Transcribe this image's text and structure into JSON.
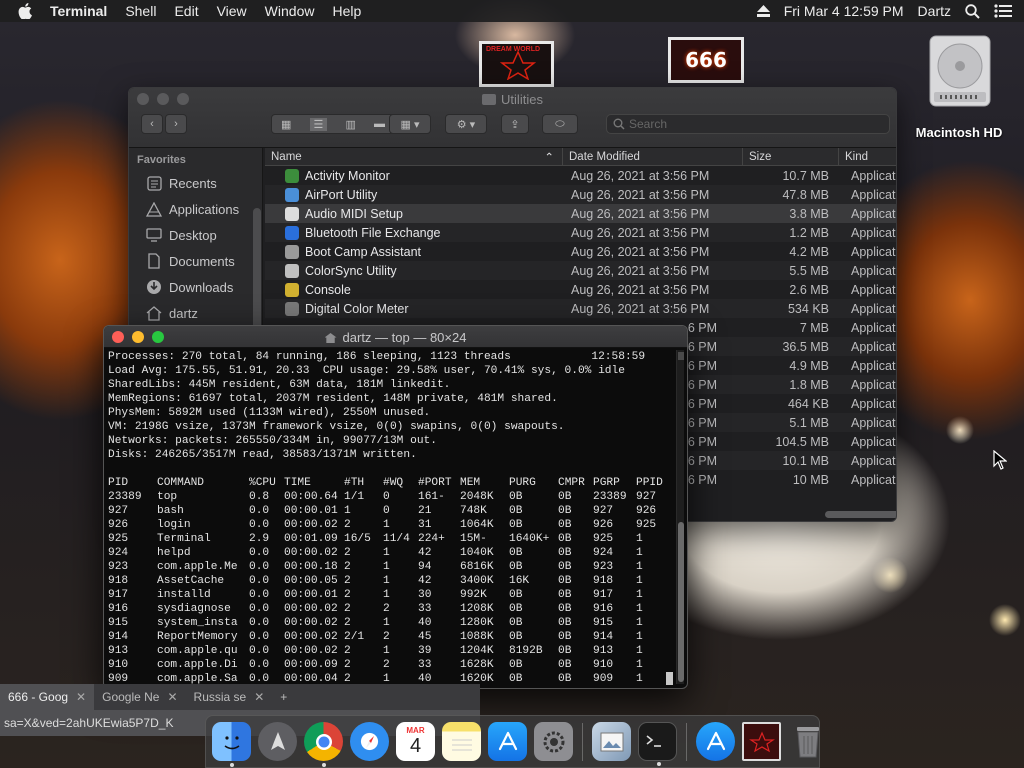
{
  "menubar": {
    "app": "Terminal",
    "items": [
      "Shell",
      "Edit",
      "View",
      "Window",
      "Help"
    ],
    "clock": "Fri Mar 4  12:59 PM",
    "user": "Dartz"
  },
  "desktop": {
    "drive_label": "Macintosh HD",
    "thumb2_text": "666",
    "thumb1_text": "DREAM WORLD"
  },
  "finder": {
    "title": "Utilities",
    "search_placeholder": "Search",
    "sidebar_header": "Favorites",
    "sidebar_items": [
      {
        "label": "Recents",
        "icon": "clock-icon"
      },
      {
        "label": "Applications",
        "icon": "applications-icon"
      },
      {
        "label": "Desktop",
        "icon": "desktop-icon"
      },
      {
        "label": "Documents",
        "icon": "document-icon"
      },
      {
        "label": "Downloads",
        "icon": "download-icon"
      },
      {
        "label": "dartz",
        "icon": "home-icon"
      }
    ],
    "columns": [
      "Name",
      "Date Modified",
      "Size",
      "Kind"
    ],
    "rows": [
      {
        "name": "Activity Monitor",
        "date": "Aug 26, 2021 at 3:56 PM",
        "size": "10.7 MB",
        "kind": "Applicat",
        "color": "#3c8d3c"
      },
      {
        "name": "AirPort Utility",
        "date": "Aug 26, 2021 at 3:56 PM",
        "size": "47.8 MB",
        "kind": "Applicat",
        "color": "#4a8fd8"
      },
      {
        "name": "Audio MIDI Setup",
        "date": "Aug 26, 2021 at 3:56 PM",
        "size": "3.8 MB",
        "kind": "Applicat",
        "color": "#dddddd"
      },
      {
        "name": "Bluetooth File Exchange",
        "date": "Aug 26, 2021 at 3:56 PM",
        "size": "1.2 MB",
        "kind": "Applicat",
        "color": "#2a6fdc"
      },
      {
        "name": "Boot Camp Assistant",
        "date": "Aug 26, 2021 at 3:56 PM",
        "size": "4.2 MB",
        "kind": "Applicat",
        "color": "#9a9a9a"
      },
      {
        "name": "ColorSync Utility",
        "date": "Aug 26, 2021 at 3:56 PM",
        "size": "5.5 MB",
        "kind": "Applicat",
        "color": "#c0c0c0"
      },
      {
        "name": "Console",
        "date": "Aug 26, 2021 at 3:56 PM",
        "size": "2.6 MB",
        "kind": "Applicat",
        "color": "#d0b030"
      },
      {
        "name": "Digital Color Meter",
        "date": "Aug 26, 2021 at 3:56 PM",
        "size": "534 KB",
        "kind": "Applicat",
        "color": "#7a7a7a"
      },
      {
        "name": "",
        "date": "6 PM",
        "size": "7 MB",
        "kind": "Applicat",
        "color": ""
      },
      {
        "name": "",
        "date": "6 PM",
        "size": "36.5 MB",
        "kind": "Applicat",
        "color": ""
      },
      {
        "name": "",
        "date": "6 PM",
        "size": "4.9 MB",
        "kind": "Applicat",
        "color": ""
      },
      {
        "name": "",
        "date": "6 PM",
        "size": "1.8 MB",
        "kind": "Applicat",
        "color": ""
      },
      {
        "name": "",
        "date": "6 PM",
        "size": "464 KB",
        "kind": "Applicat",
        "color": ""
      },
      {
        "name": "",
        "date": "6 PM",
        "size": "5.1 MB",
        "kind": "Applicat",
        "color": ""
      },
      {
        "name": "",
        "date": "6 PM",
        "size": "104.5 MB",
        "kind": "Applicat",
        "color": ""
      },
      {
        "name": "",
        "date": "6 PM",
        "size": "10.1 MB",
        "kind": "Applicat",
        "color": ""
      },
      {
        "name": "",
        "date": "6 PM",
        "size": "10 MB",
        "kind": "Applicat",
        "color": ""
      }
    ]
  },
  "terminal": {
    "title": "dartz — top — 80×24",
    "header_lines": [
      "Processes: 270 total, 84 running, 186 sleeping, 1123 threads            12:58:59",
      "Load Avg: 175.55, 51.91, 20.33  CPU usage: 29.58% user, 70.41% sys, 0.0% idle",
      "SharedLibs: 445M resident, 63M data, 181M linkedit.",
      "MemRegions: 61697 total, 2037M resident, 148M private, 481M shared.",
      "PhysMem: 5892M used (1133M wired), 2550M unused.",
      "VM: 2198G vsize, 1373M framework vsize, 0(0) swapins, 0(0) swapouts.",
      "Networks: packets: 265550/334M in, 99077/13M out.",
      "Disks: 246265/3517M read, 38583/1371M written.",
      ""
    ],
    "columns": [
      "PID",
      "COMMAND",
      "%CPU",
      "TIME",
      "#TH",
      "#WQ",
      "#PORT",
      "MEM",
      "PURG",
      "CMPR",
      "PGRP",
      "PPID"
    ],
    "processes": [
      [
        "23389",
        "top",
        "0.8",
        "00:00.64",
        "1/1",
        "0",
        "161-",
        "2048K",
        "0B",
        "0B",
        "23389",
        "927"
      ],
      [
        "927",
        "bash",
        "0.0",
        "00:00.01",
        "1",
        "0",
        "21",
        "748K",
        "0B",
        "0B",
        "927",
        "926"
      ],
      [
        "926",
        "login",
        "0.0",
        "00:00.02",
        "2",
        "1",
        "31",
        "1064K",
        "0B",
        "0B",
        "926",
        "925"
      ],
      [
        "925",
        "Terminal",
        "2.9",
        "00:01.09",
        "16/5",
        "11/4",
        "224+",
        "15M-",
        "1640K+",
        "0B",
        "925",
        "1"
      ],
      [
        "924",
        "helpd",
        "0.0",
        "00:00.02",
        "2",
        "1",
        "42",
        "1040K",
        "0B",
        "0B",
        "924",
        "1"
      ],
      [
        "923",
        "com.apple.Me",
        "0.0",
        "00:00.18",
        "2",
        "1",
        "94",
        "6816K",
        "0B",
        "0B",
        "923",
        "1"
      ],
      [
        "918",
        "AssetCache",
        "0.0",
        "00:00.05",
        "2",
        "1",
        "42",
        "3400K",
        "16K",
        "0B",
        "918",
        "1"
      ],
      [
        "917",
        "installd",
        "0.0",
        "00:00.01",
        "2",
        "1",
        "30",
        "992K",
        "0B",
        "0B",
        "917",
        "1"
      ],
      [
        "916",
        "sysdiagnose",
        "0.0",
        "00:00.02",
        "2",
        "2",
        "33",
        "1208K",
        "0B",
        "0B",
        "916",
        "1"
      ],
      [
        "915",
        "system_insta",
        "0.0",
        "00:00.02",
        "2",
        "1",
        "40",
        "1280K",
        "0B",
        "0B",
        "915",
        "1"
      ],
      [
        "914",
        "ReportMemory",
        "0.0",
        "00:00.02",
        "2/1",
        "2",
        "45",
        "1088K",
        "0B",
        "0B",
        "914",
        "1"
      ],
      [
        "913",
        "com.apple.qu",
        "0.0",
        "00:00.02",
        "2",
        "1",
        "39",
        "1204K",
        "8192B",
        "0B",
        "913",
        "1"
      ],
      [
        "910",
        "com.apple.Di",
        "0.0",
        "00:00.09",
        "2",
        "2",
        "33",
        "1628K",
        "0B",
        "0B",
        "910",
        "1"
      ],
      [
        "909",
        "com.apple.Sa",
        "0.0",
        "00:00.04",
        "2",
        "1",
        "40",
        "1620K",
        "0B",
        "0B",
        "909",
        "1"
      ]
    ]
  },
  "browser": {
    "tabs": [
      {
        "label": "666 - Goog",
        "active": true
      },
      {
        "label": "Google Ne",
        "active": false
      },
      {
        "label": "Russia se",
        "active": false
      }
    ],
    "url": "sa=X&ved=2ahUKEwia5P7D_K"
  },
  "dock": {
    "items": [
      {
        "name": "finder",
        "color": "#3a86e8",
        "running": true
      },
      {
        "name": "launchpad",
        "color": "#6c6c70",
        "running": false
      },
      {
        "name": "chrome",
        "color": "#e8e8e8",
        "running": true
      },
      {
        "name": "safari",
        "color": "#2f8ef0",
        "running": false
      },
      {
        "name": "calendar",
        "color": "#ffffff",
        "running": false
      },
      {
        "name": "notes",
        "color": "#f7e06a",
        "running": false
      },
      {
        "name": "app-store",
        "color": "#1f8cf0",
        "running": false
      },
      {
        "name": "system-preferences",
        "color": "#8e8e92",
        "running": false
      },
      {
        "name": "preview",
        "color": "#b8c8d8",
        "running": false
      },
      {
        "name": "terminal",
        "color": "#1a1a1a",
        "running": true
      },
      {
        "name": "app-store-downloads",
        "color": "#1f8cf0",
        "running": false
      },
      {
        "name": "photo-thumbnail",
        "color": "#7a1a1a",
        "running": false
      },
      {
        "name": "trash",
        "color": "#7d7d80",
        "running": false
      }
    ],
    "calendar_month": "MAR",
    "calendar_day": "4"
  }
}
